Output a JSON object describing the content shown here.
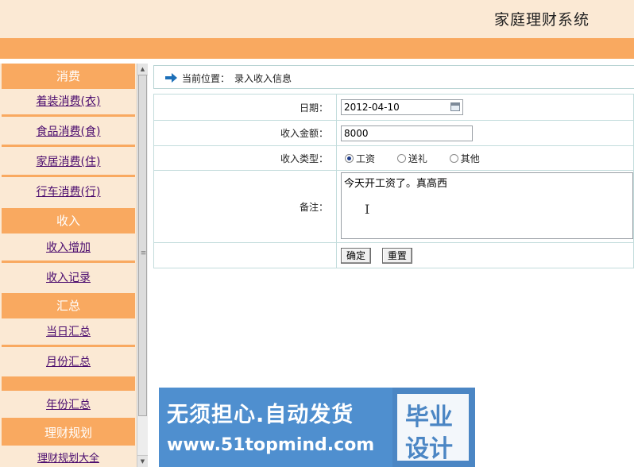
{
  "header": {
    "title": "家庭理财系统"
  },
  "sidebar": {
    "sections": [
      {
        "type": "category",
        "label": "消费"
      },
      {
        "type": "item",
        "label": "着装消费(衣)"
      },
      {
        "type": "item",
        "label": "食品消费(食)"
      },
      {
        "type": "item",
        "label": "家居消费(住)"
      },
      {
        "type": "item",
        "label": "行车消费(行)"
      },
      {
        "type": "category",
        "label": "收入"
      },
      {
        "type": "item",
        "label": "收入增加"
      },
      {
        "type": "item",
        "label": "收入记录"
      },
      {
        "type": "category",
        "label": "汇总"
      },
      {
        "type": "item",
        "label": "当日汇总"
      },
      {
        "type": "item",
        "label": "月份汇总"
      },
      {
        "type": "category",
        "label": ""
      },
      {
        "type": "item",
        "label": "年份汇总"
      },
      {
        "type": "category",
        "label": "理财规划"
      },
      {
        "type": "item",
        "label": "理财规划大全"
      }
    ]
  },
  "breadcrumb": {
    "label": "当前位置：",
    "value": "录入收入信息"
  },
  "form": {
    "date_label": "日期：",
    "date_value": "2012-04-10",
    "amount_label": "收入金额：",
    "amount_value": "8000",
    "type_label": "收入类型：",
    "type_options": [
      {
        "label": "工资",
        "checked": true
      },
      {
        "label": "送礼",
        "checked": false
      },
      {
        "label": "其他",
        "checked": false
      }
    ],
    "remark_label": "备注：",
    "remark_value": "今天开工资了。真高西",
    "submit_label": "确定",
    "reset_label": "重置"
  },
  "watermark": {
    "line1": "无须担心.自动发货",
    "line2": "www.51topmind.com",
    "badge_line1": "毕业",
    "badge_line2": "设计"
  },
  "colors": {
    "header_bg": "#fbe9d4",
    "accent_orange": "#f9a960",
    "link_color": "#4a0b6e",
    "table_border": "#c3dcdc",
    "watermark_blue": "#4b86c4"
  }
}
